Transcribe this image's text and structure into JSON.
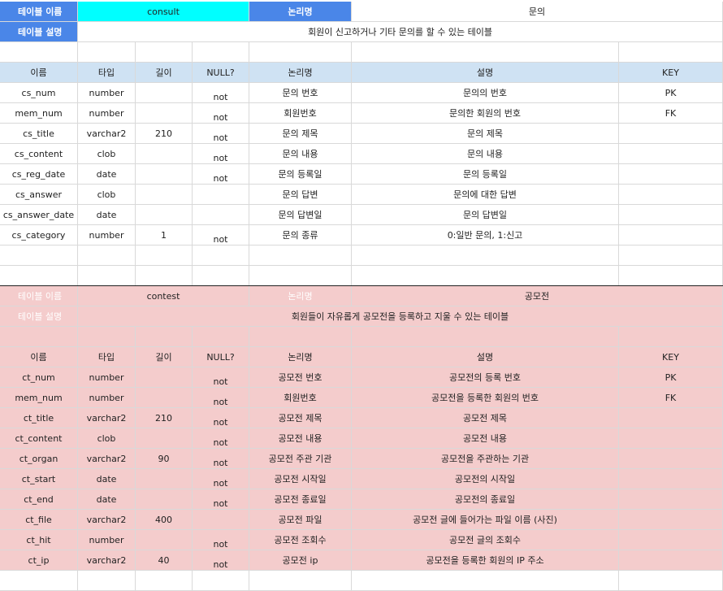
{
  "consult": {
    "table_name_label": "테이블 이름",
    "table_name": "consult",
    "logical_name_label": "논리명",
    "logical_name": "문의",
    "desc_label": "테이블 설명",
    "description": "회원이 신고하거나 기타 문의를 할 수 있는 테이블",
    "headers": [
      "이름",
      "타입",
      "길이",
      "NULL?",
      "논리명",
      "설명",
      "KEY"
    ],
    "rows": [
      {
        "name": "cs_num",
        "type": "number",
        "len": "",
        "null": "not",
        "logical": "문의 번호",
        "desc": "문의의 번호",
        "key": "PK"
      },
      {
        "name": "mem_num",
        "type": "number",
        "len": "",
        "null": "not",
        "logical": "회원번호",
        "desc": "문의한 회원의 번호",
        "key": "FK"
      },
      {
        "name": "cs_title",
        "type": "varchar2",
        "len": "210",
        "null": "not",
        "logical": "문의 제목",
        "desc": "문의 제목",
        "key": ""
      },
      {
        "name": "cs_content",
        "type": "clob",
        "len": "",
        "null": "not",
        "logical": "문의 내용",
        "desc": "문의 내용",
        "key": ""
      },
      {
        "name": "cs_reg_date",
        "type": "date",
        "len": "",
        "null": "not",
        "logical": "문의 등록일",
        "desc": "문의 등록일",
        "key": ""
      },
      {
        "name": "cs_answer",
        "type": "clob",
        "len": "",
        "null": "",
        "logical": "문의 답변",
        "desc": "문의에 대한 답변",
        "key": ""
      },
      {
        "name": "cs_answer_date",
        "type": "date",
        "len": "",
        "null": "",
        "logical": "문의 답변일",
        "desc": "문의 답변일",
        "key": ""
      },
      {
        "name": "cs_category",
        "type": "number",
        "len": "1",
        "null": "not",
        "logical": "문의 종류",
        "desc": "0:일반 문의, 1:신고",
        "key": ""
      }
    ]
  },
  "contest": {
    "table_name_label": "테이블 이름",
    "table_name": "contest",
    "logical_name_label": "논리명",
    "logical_name": "공모전",
    "desc_label": "테이블 설명",
    "description": "회원들이 자유롭게 공모전을 등록하고 지울 수 있는 테이블",
    "headers": [
      "이름",
      "타입",
      "길이",
      "NULL?",
      "논리명",
      "설명",
      "KEY"
    ],
    "rows": [
      {
        "name": "ct_num",
        "type": "number",
        "len": "",
        "null": "not",
        "logical": "공모전 번호",
        "desc": "공모전의 등록 번호",
        "key": "PK"
      },
      {
        "name": "mem_num",
        "type": "number",
        "len": "",
        "null": "not",
        "logical": "회원번호",
        "desc": "공모전을 등록한 회원의 번호",
        "key": "FK"
      },
      {
        "name": "ct_title",
        "type": "varchar2",
        "len": "210",
        "null": "not",
        "logical": "공모전 제목",
        "desc": "공모전 제목",
        "key": ""
      },
      {
        "name": "ct_content",
        "type": "clob",
        "len": "",
        "null": "not",
        "logical": "공모전 내용",
        "desc": "공모전 내용",
        "key": ""
      },
      {
        "name": "ct_organ",
        "type": "varchar2",
        "len": "90",
        "null": "not",
        "logical": "공모전 주관 기관",
        "desc": "공모전을 주관하는 기관",
        "key": ""
      },
      {
        "name": "ct_start",
        "type": "date",
        "len": "",
        "null": "not",
        "logical": "공모전 시작일",
        "desc": "공모전의 시작일",
        "key": ""
      },
      {
        "name": "ct_end",
        "type": "date",
        "len": "",
        "null": "not",
        "logical": "공모전 종료일",
        "desc": "공모전의 종료일",
        "key": ""
      },
      {
        "name": "ct_file",
        "type": "varchar2",
        "len": "400",
        "null": "",
        "logical": "공모전 파일",
        "desc": "공모전 글에 들어가는 파일 이름 (사진)",
        "key": ""
      },
      {
        "name": "ct_hit",
        "type": "number",
        "len": "",
        "null": "not",
        "logical": "공모전 조회수",
        "desc": "공모전 글의 조회수",
        "key": ""
      },
      {
        "name": "ct_ip",
        "type": "varchar2",
        "len": "40",
        "null": "not",
        "logical": "공모전 ip",
        "desc": "공모전을 등록한 회원의 IP 주소",
        "key": ""
      }
    ]
  }
}
